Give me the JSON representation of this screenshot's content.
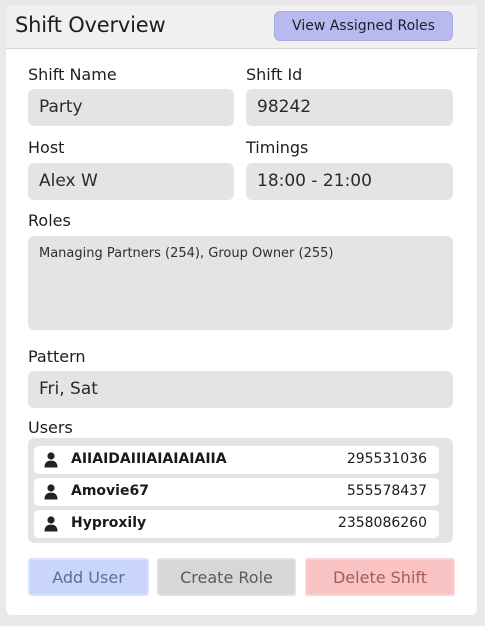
{
  "header": {
    "title": "Shift Overview",
    "view_roles_label": "View Assigned Roles"
  },
  "form": {
    "shift_name": {
      "label": "Shift Name",
      "value": "Party"
    },
    "shift_id": {
      "label": "Shift Id",
      "value": "98242"
    },
    "host": {
      "label": "Host",
      "value": "Alex W"
    },
    "timings": {
      "label": "Timings",
      "value": "18:00 - 21:00"
    },
    "roles": {
      "label": "Roles",
      "value": "Managing Partners (254), Group Owner (255)"
    },
    "pattern": {
      "label": "Pattern",
      "value": "Fri, Sat"
    }
  },
  "users": {
    "label": "Users",
    "items": [
      {
        "name": "AIIAIDAIIIAIAIAIAIIA",
        "id": "295531036",
        "icon": "user-icon"
      },
      {
        "name": "Amovie67",
        "id": "555578437",
        "icon": "user-icon"
      },
      {
        "name": "Hyproxily",
        "id": "2358086260",
        "icon": "user-icon"
      }
    ]
  },
  "actions": {
    "add_user": "Add User",
    "create_role": "Create Role",
    "delete_shift": "Delete Shift"
  },
  "colors": {
    "accent": "#b8b9ee",
    "add": "#c9d6f9",
    "create": "#d7d7d7",
    "delete": "#f9c3c3",
    "field": "#e3e5e5"
  }
}
